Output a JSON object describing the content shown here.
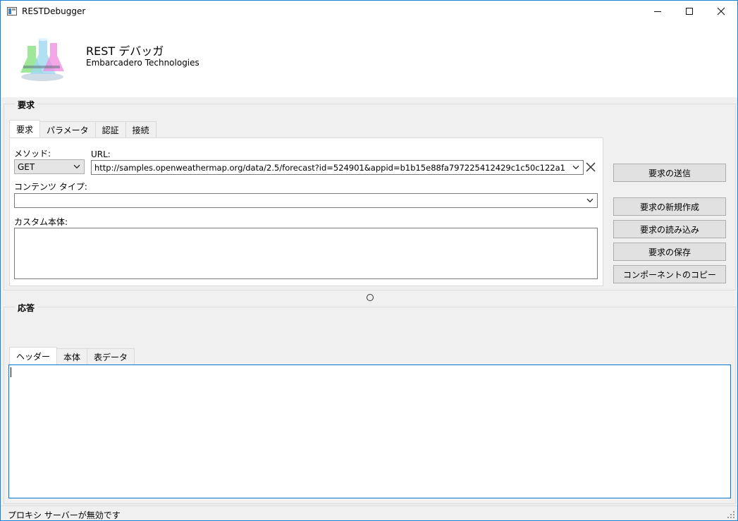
{
  "window": {
    "title": "RESTDebugger"
  },
  "header": {
    "title": "REST デバッガ",
    "subtitle": "Embarcadero Technologies"
  },
  "request": {
    "group_label": "要求",
    "tabs": [
      "要求",
      "パラメータ",
      "認証",
      "接続"
    ],
    "active_tab": "要求",
    "method_label": "メソッド:",
    "method_value": "GET",
    "url_label": "URL:",
    "url_value": "http://samples.openweathermap.org/data/2.5/forecast?id=524901&appid=b1b15e88fa797225412429c1c50c122a1",
    "content_type_label": "コンテンツ タイプ:",
    "content_type_value": "",
    "custom_body_label": "カスタム本体:",
    "custom_body_value": ""
  },
  "actions": {
    "send": "要求の送信",
    "new": "要求の新規作成",
    "load": "要求の読み込み",
    "save": "要求の保存",
    "copy_components": "コンポーネントのコピー"
  },
  "response": {
    "group_label": "応答",
    "tabs": [
      "ヘッダー",
      "本体",
      "表データ"
    ],
    "active_tab": "ヘッダー",
    "content": ""
  },
  "status": {
    "text": "プロキシ サーバーが無効です"
  },
  "colors": {
    "accent": "#0078d7",
    "window_border": "#1883d7",
    "background": "#f0f0f0",
    "button_face": "#e1e1e1"
  },
  "icons": [
    "app-icon",
    "flask-logo-icon",
    "minimize-icon",
    "maximize-icon",
    "close-icon",
    "chevron-down-icon",
    "clear-x-icon",
    "size-grip-icon"
  ]
}
